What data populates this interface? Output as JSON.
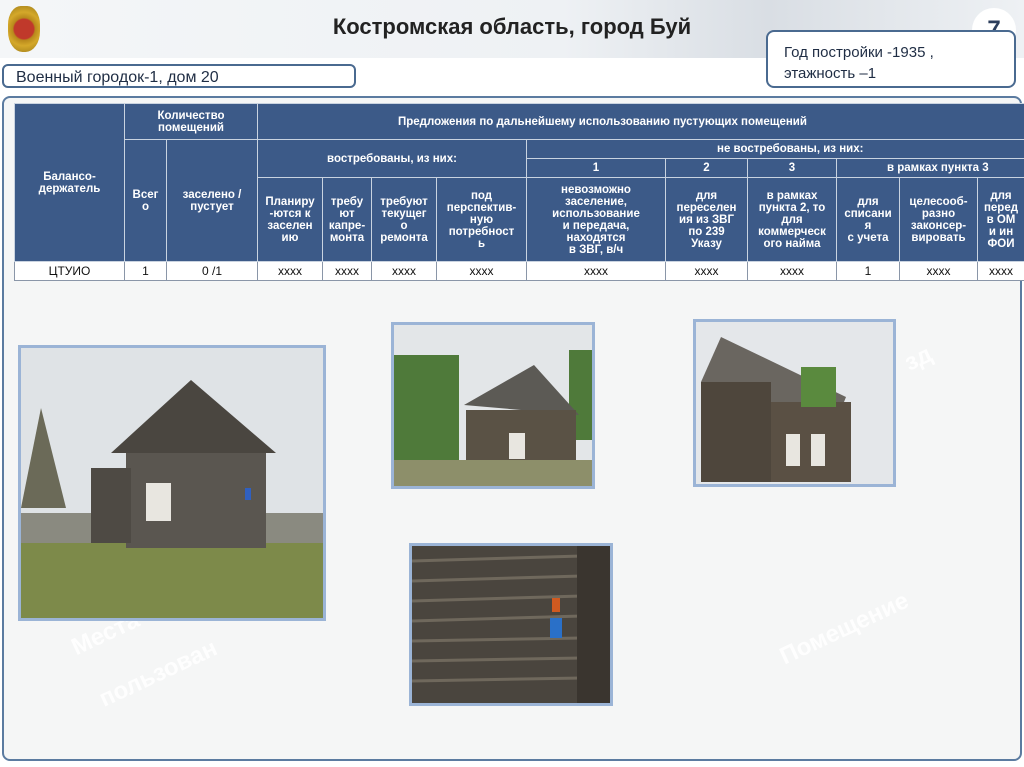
{
  "header": {
    "title": "Костромская область, город Буй",
    "page_number": "7"
  },
  "address": "Военный городок-1, дом  20",
  "info": {
    "line1": "Год постройки  -1935 ,",
    "line2": "этажность –1"
  },
  "table": {
    "h_holder": "Балансо-\nдержатель",
    "h_count": "Количество\nпомещений",
    "h_total": "Всег\nо",
    "h_occupied": "заселено /\nпустует",
    "h_proposals": "Предложения по дальнейшему использованию пустующих помещений",
    "h_demanded": "востребованы, из них:",
    "h_not_demanded": "не востребованы, из них:",
    "h_n1": "1",
    "h_n2": "2",
    "h_n3": "3",
    "h_within3": "в рамках пункта 3",
    "cols": [
      "Планиру\n-ются к\nзаселен\nию",
      "требу\nют\nкапре-\nмонта",
      "требуют\nтекущег\nо\nремонта",
      "под\nперспектив-\nную\nпотребност\nь",
      "невозможно\nзаселение,\nиспользование\nи передача,\nнаходятся\nв ЗВГ, в/ч",
      "для\nпереселен\nия из ЗВГ\nпо 239\nУказу",
      "в рамках\nпункта 2, то\nдля\nкоммерческ\nого найма",
      "для\nсписани\nя\nс учета",
      "целесооб-\nразно\nзаконсер-\nвировать",
      "для\nперед\nв ОМ\nи ин\nФОИ"
    ],
    "row": [
      "ЦТУИО",
      "1",
      "0 /1",
      "xxxx",
      "xxxx",
      "xxxx",
      "xxxx",
      "xxxx",
      "xxxx",
      "xxxx",
      "1",
      "xxxx",
      "xxxx"
    ]
  },
  "watermarks": [
    "Места",
    "пользован",
    "Помещение",
    "зд"
  ]
}
